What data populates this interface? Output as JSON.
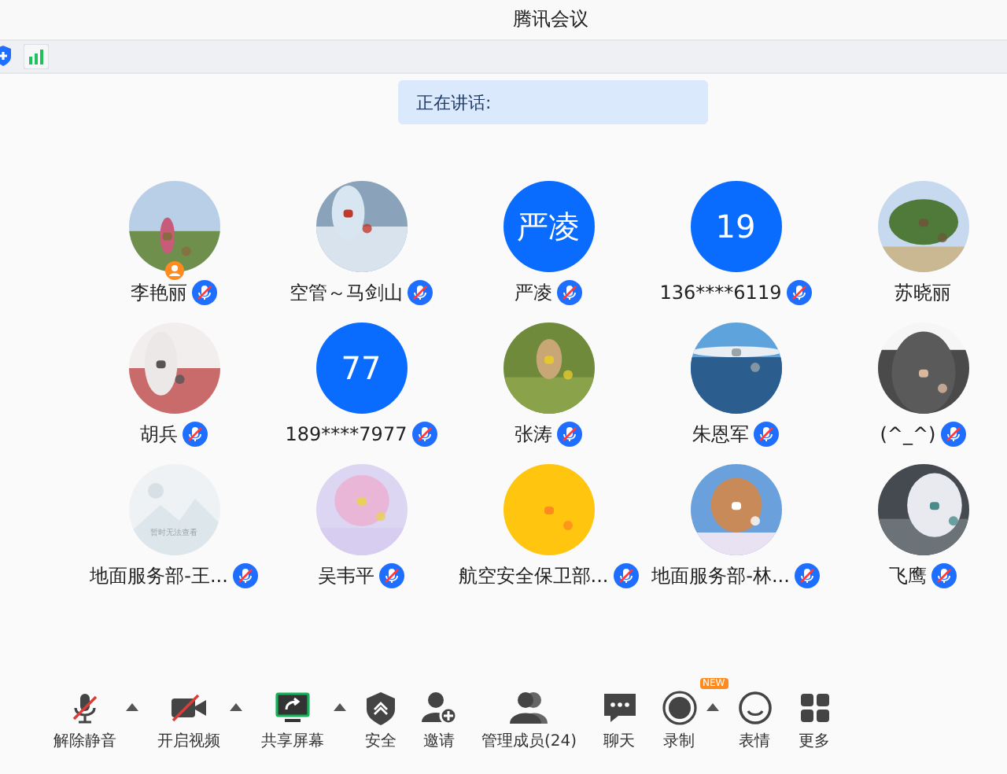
{
  "window": {
    "title": "腾讯会议"
  },
  "speaking_banner": {
    "label": "正在讲话:"
  },
  "participants": [
    {
      "name": "李艳丽",
      "muted": true,
      "host": true
    },
    {
      "name": "空管～马剑山",
      "muted": true,
      "host": false
    },
    {
      "name": "严凌",
      "avatar": {
        "kind": "text",
        "text": "严凌"
      },
      "muted": true,
      "host": false
    },
    {
      "name": "136****6119",
      "avatar": {
        "kind": "text",
        "text": "19"
      },
      "muted": true,
      "host": false
    },
    {
      "name": "苏晓丽",
      "muted": false,
      "host": false
    },
    {
      "name": "胡兵",
      "muted": true,
      "host": false
    },
    {
      "name": "189****7977",
      "avatar": {
        "kind": "text",
        "text": "77"
      },
      "muted": true,
      "host": false
    },
    {
      "name": "张涛",
      "muted": true,
      "host": false
    },
    {
      "name": "朱恩军",
      "muted": true,
      "host": false
    },
    {
      "name": "(^_^)",
      "muted": true,
      "host": false
    },
    {
      "name": "地面服务部-王...",
      "avatar": {
        "kind": "placeholder",
        "caption": "暂时无法查看"
      },
      "muted": true,
      "host": false
    },
    {
      "name": "吴韦平",
      "muted": true,
      "host": false
    },
    {
      "name": "航空安全保卫部...",
      "muted": true,
      "host": false
    },
    {
      "name": "地面服务部-林...",
      "muted": true,
      "host": false
    },
    {
      "name": "飞鹰",
      "muted": true,
      "host": false
    }
  ],
  "toolbar": [
    {
      "label": "解除静音",
      "kind": "mic",
      "menu": true
    },
    {
      "label": "开启视频",
      "kind": "video",
      "menu": true
    },
    {
      "label": "共享屏幕",
      "kind": "share",
      "menu": true
    },
    {
      "label": "安全",
      "kind": "security",
      "menu": false
    },
    {
      "label": "邀请",
      "kind": "invite",
      "menu": false
    },
    {
      "label": "管理成员(24)",
      "kind": "members",
      "menu": false
    },
    {
      "label": "聊天",
      "kind": "chat",
      "menu": false
    },
    {
      "label": "录制",
      "kind": "record",
      "menu": true,
      "badge": "NEW"
    },
    {
      "label": "表情",
      "kind": "emoji",
      "menu": false
    },
    {
      "label": "更多",
      "kind": "more",
      "menu": false
    }
  ]
}
